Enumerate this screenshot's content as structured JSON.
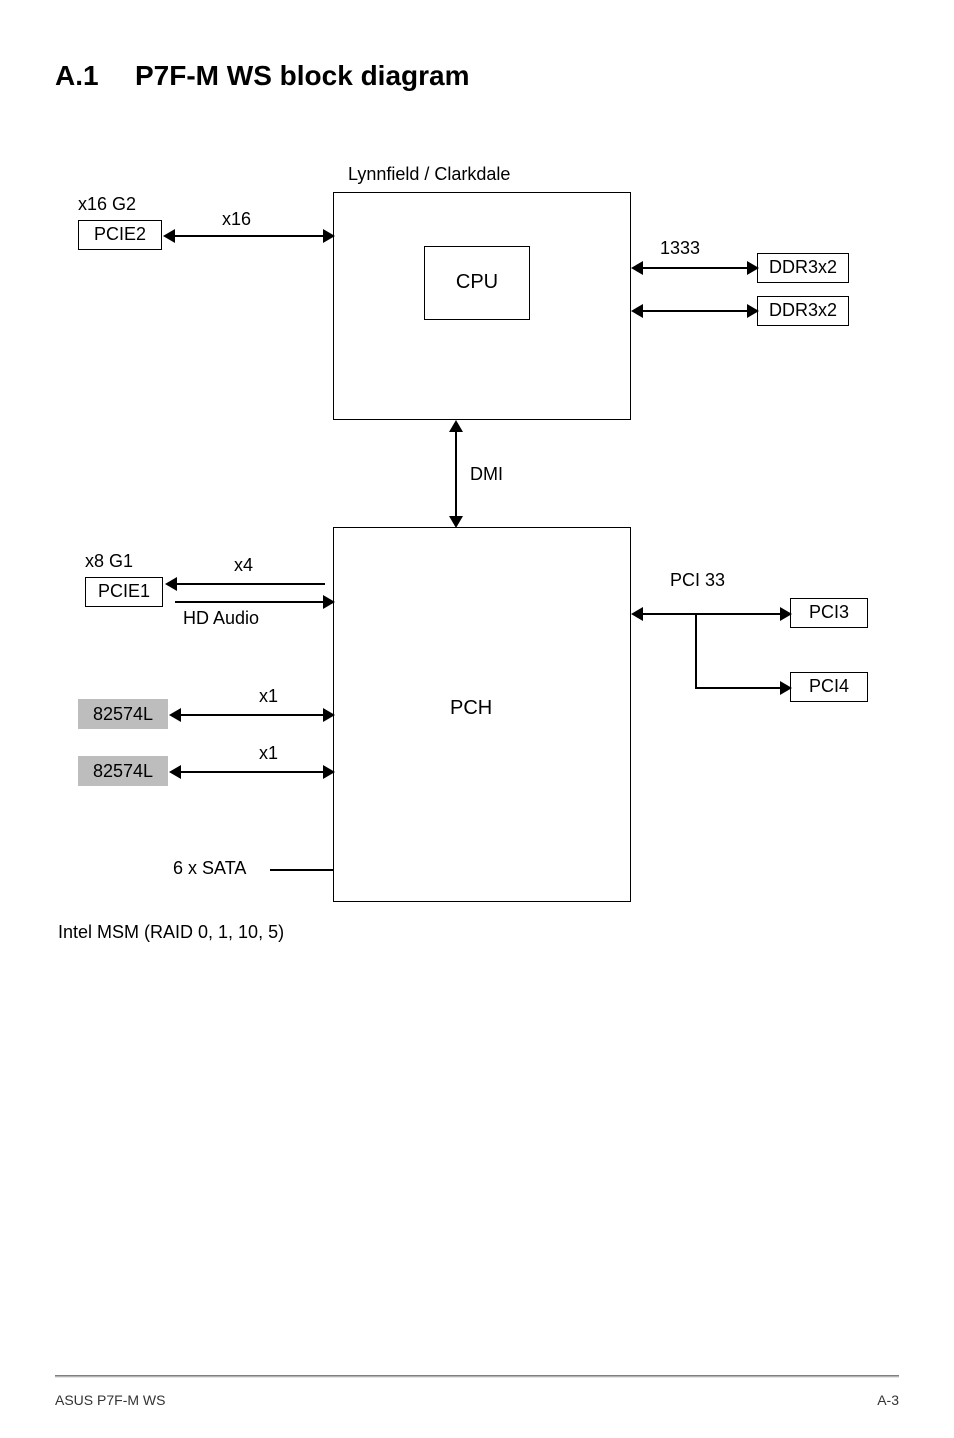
{
  "title": {
    "num": "A.1",
    "text": "P7F-M WS block diagram"
  },
  "diagram": {
    "top_label": "Lynnfield / Clarkdale",
    "cpu": "CPU",
    "pch": "PCH",
    "pcie2": {
      "name": "PCIE2",
      "label": "x16 G2",
      "link": "x16"
    },
    "ddr": {
      "speed": "1333",
      "a": "DDR3x2",
      "b": "DDR3x2"
    },
    "dmi": "DMI",
    "pcie1": {
      "name": "PCIE1",
      "label": "x8 G1",
      "link": "x4",
      "audio": "HD Audio"
    },
    "net": {
      "a": "82574L",
      "b": "82574L",
      "x1a": "x1",
      "x1b": "x1"
    },
    "pci": {
      "bus": "PCI 33",
      "a": "PCI3",
      "b": "PCI4"
    },
    "sata": "6 x SATA",
    "raid_note": "Intel MSM (RAID 0, 1, 10, 5)"
  },
  "footer": {
    "left": "ASUS P7F-M WS",
    "right": "A-3"
  }
}
